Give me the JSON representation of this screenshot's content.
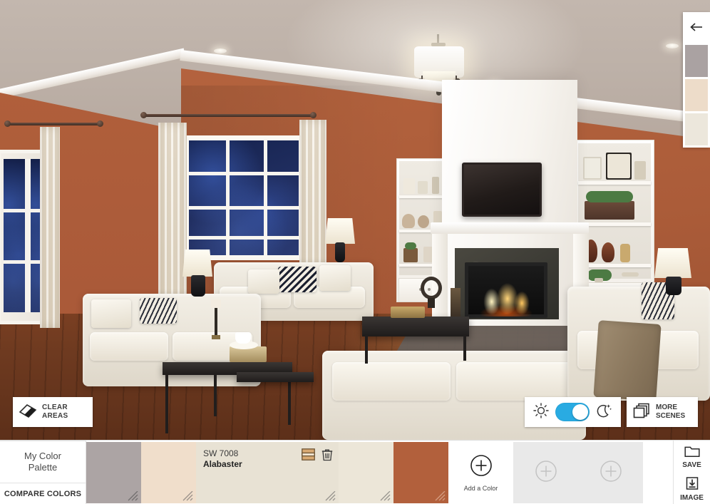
{
  "scene": {
    "name": "living-room-night-scene",
    "wall_color": "#b05f3b",
    "ceiling_color": "#bdb1a8",
    "trim_color": "#ffffff",
    "floor_color": "#6e3a20"
  },
  "overlay": {
    "clear_areas": {
      "label_line1": "CLEAR",
      "label_line2": "AREAS",
      "icon": "eraser-icon"
    },
    "daynight": {
      "sun_icon": "sun-icon",
      "moon_icon": "moon-stars-icon",
      "state": "day",
      "accent": "#29ABE2"
    },
    "more_scenes": {
      "label_line1": "MORE",
      "label_line2": "SCENES",
      "icon": "layers-icon"
    }
  },
  "side_panel": {
    "back_icon": "arrow-left-icon",
    "swatches": [
      {
        "name": "side-swatch-1",
        "color": "#aaa2a2"
      },
      {
        "name": "side-swatch-2",
        "color": "#eddcc9"
      },
      {
        "name": "side-swatch-3",
        "color": "#ece7dc"
      }
    ]
  },
  "palette": {
    "title_line1": "My Color",
    "title_line2": "Palette",
    "compare_label": "COMPARE COLORS",
    "swatches": [
      {
        "code": "",
        "name": "",
        "color": "#aca4a4",
        "wide": false,
        "selected": false
      },
      {
        "code": "",
        "name": "",
        "color": "#f0decb",
        "wide": false,
        "selected": false
      },
      {
        "code": "SW 7008",
        "name": "Alabaster",
        "color": "#e8e2d4",
        "wide": true,
        "selected": true,
        "coordinating_icon": "coordinating-colors-icon",
        "delete_icon": "trash-icon"
      },
      {
        "code": "",
        "name": "",
        "color": "#ece6d8",
        "wide": false,
        "selected": false
      },
      {
        "code": "",
        "name": "",
        "color": "#b2603c",
        "wide": false,
        "selected": false
      }
    ],
    "add_slot": {
      "label": "Add a Color",
      "icon": "plus-circle-icon"
    },
    "empty_slots": [
      {
        "name": "empty-slot-1",
        "icon": "plus-circle-icon"
      },
      {
        "name": "empty-slot-2",
        "icon": "plus-circle-icon"
      }
    ],
    "save": {
      "label": "SAVE",
      "icon": "folder-icon"
    },
    "image": {
      "label": "IMAGE",
      "icon": "save-image-icon"
    }
  }
}
